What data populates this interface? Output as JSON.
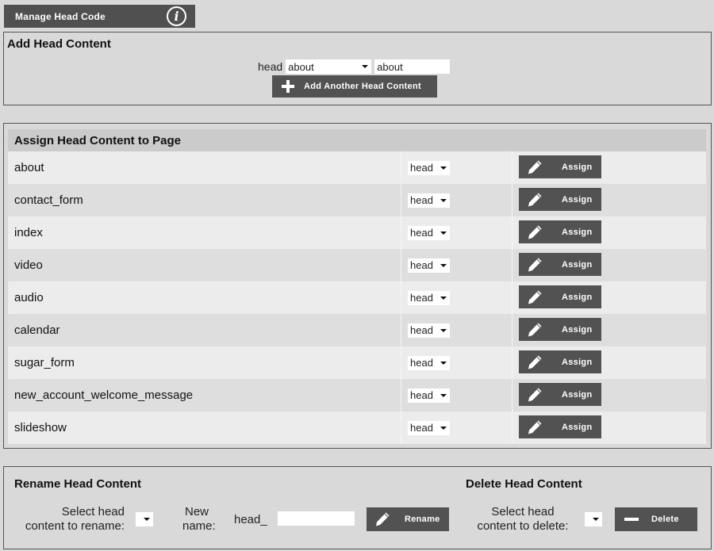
{
  "header": {
    "title": "Manage Head Code",
    "info_icon": "info-icon"
  },
  "add_section": {
    "title": "Add Head Content",
    "prefix_label": "head",
    "select_value": "about",
    "input_value": "about",
    "add_button_label": "Add Another Head Content",
    "add_button_icon": "plus-icon"
  },
  "assign_section": {
    "title": "Assign Head Content to Page",
    "button_icon": "pencil-icon",
    "rows": [
      {
        "page": "about",
        "select_value": "head",
        "button_label": "Assign"
      },
      {
        "page": "contact_form",
        "select_value": "head",
        "button_label": "Assign"
      },
      {
        "page": "index",
        "select_value": "head",
        "button_label": "Assign"
      },
      {
        "page": "video",
        "select_value": "head",
        "button_label": "Assign"
      },
      {
        "page": "audio",
        "select_value": "head",
        "button_label": "Assign"
      },
      {
        "page": "calendar",
        "select_value": "head",
        "button_label": "Assign"
      },
      {
        "page": "sugar_form",
        "select_value": "head",
        "button_label": "Assign"
      },
      {
        "page": "new_account_welcome_message",
        "select_value": "head",
        "button_label": "Assign"
      },
      {
        "page": "slideshow",
        "select_value": "head",
        "button_label": "Assign"
      }
    ]
  },
  "rename_section": {
    "title": "Rename Head Content",
    "select_label_line1": "Select head",
    "select_label_line2": "content to rename:",
    "select_value": "",
    "new_name_line1": "New",
    "new_name_line2": "name:",
    "prefix": "head_",
    "input_value": "",
    "button_label": "Rename",
    "button_icon": "pencil-icon"
  },
  "delete_section": {
    "title": "Delete Head Content",
    "select_label_line1": "Select head",
    "select_label_line2": "content to delete:",
    "select_value": "",
    "button_label": "Delete",
    "button_icon": "minus-icon"
  }
}
